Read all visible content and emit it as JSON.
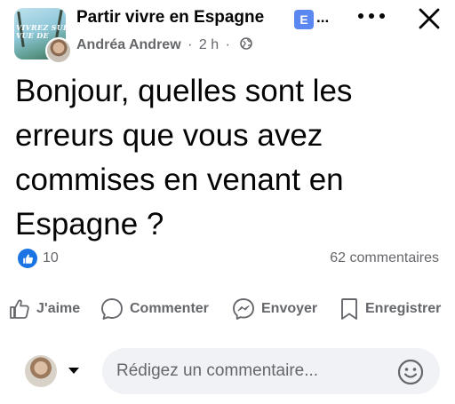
{
  "header": {
    "group_name": "Partir vivre en Espagne",
    "group_badge": "E",
    "group_ellipsis": "...",
    "author": "Andréa Andrew",
    "separator": "·",
    "time": "2 h",
    "privacy_icon": "globe-icon",
    "thumb_text_line1": "VIVREZ SUR LE",
    "thumb_text_line2": "VUE DE"
  },
  "post": {
    "text": "Bonjour, quelles sont les erreurs que vous avez commises en venant en Espagne ?"
  },
  "stats": {
    "reaction_icon": "like-icon",
    "reaction_count": "10",
    "comment_count": "62 commentaires"
  },
  "actions": [
    {
      "label": "J'aime",
      "icon": "thumbs-up-icon"
    },
    {
      "label": "Commenter",
      "icon": "speech-bubble-icon"
    },
    {
      "label": "Envoyer",
      "icon": "messenger-icon"
    },
    {
      "label": "Enregistrer",
      "icon": "bookmark-icon"
    }
  ],
  "comment_box": {
    "placeholder": "Rédigez un commentaire...",
    "emoji_icon": "smiley-icon"
  },
  "colors": {
    "accent": "#1b74e4",
    "badge": "#5b87f0",
    "secondary_text": "#65676b",
    "input_bg": "#f0f2f5"
  }
}
